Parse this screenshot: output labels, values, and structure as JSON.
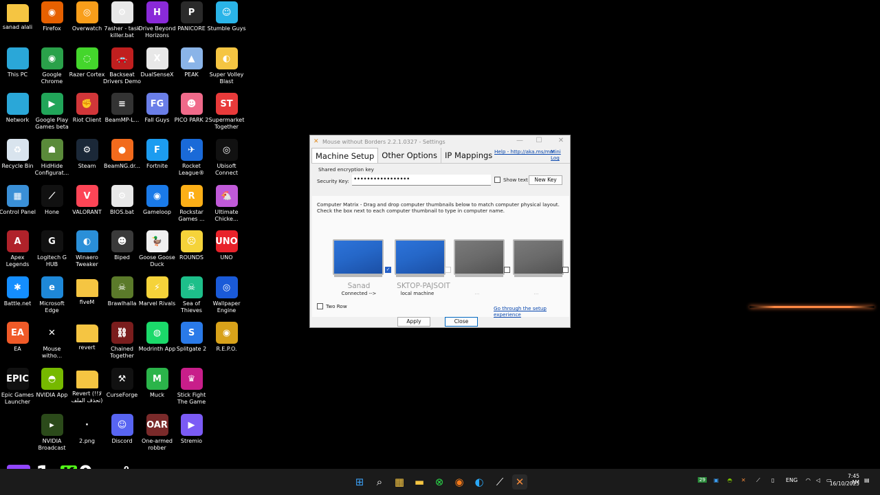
{
  "desktop": {
    "columns": [
      {
        "icons": [
          {
            "label": "sanad alali",
            "icon": "folder-icon",
            "color": "#f5c542",
            "glyph": ""
          },
          {
            "label": "This PC",
            "icon": "computer-icon",
            "color": "#2aa7d8",
            "glyph": ""
          },
          {
            "label": "Network",
            "icon": "network-icon",
            "color": "#2aa7d8",
            "glyph": ""
          },
          {
            "label": "Recycle Bin",
            "icon": "recycle-bin-icon",
            "color": "#d9e4ee",
            "glyph": "♻"
          },
          {
            "label": "Control Panel",
            "icon": "control-panel-icon",
            "color": "#3a8fd6",
            "glyph": "▦"
          },
          {
            "label": "Apex Legends",
            "icon": "apex-legends-icon",
            "color": "#b0222a",
            "glyph": "A"
          },
          {
            "label": "Battle.net",
            "icon": "battlenet-icon",
            "color": "#148eff",
            "glyph": "✱"
          },
          {
            "label": "EA",
            "icon": "ea-icon",
            "color": "#f05a28",
            "glyph": "EA"
          },
          {
            "label": "Epic Games Launcher",
            "icon": "epic-games-icon",
            "color": "#111111",
            "glyph": "EPIC"
          }
        ]
      },
      {
        "icons": [
          {
            "label": "Firefox",
            "icon": "firefox-icon",
            "color": "#e66000",
            "glyph": "◉"
          },
          {
            "label": "Google Chrome",
            "icon": "chrome-icon",
            "color": "#2aa14a",
            "glyph": "◉"
          },
          {
            "label": "Google Play Games beta",
            "icon": "google-play-games-icon",
            "color": "#21a559",
            "glyph": "▶"
          },
          {
            "label": "HidHide Configurat...",
            "icon": "hidhide-icon",
            "color": "#5a8a3a",
            "glyph": "☗"
          },
          {
            "label": "Hone",
            "icon": "hone-icon",
            "color": "#111111",
            "glyph": "⟋"
          },
          {
            "label": "Logitech G HUB",
            "icon": "logitech-ghub-icon",
            "color": "#111111",
            "glyph": "G"
          },
          {
            "label": "Microsoft Edge",
            "icon": "edge-icon",
            "color": "#1e88d8",
            "glyph": "e"
          },
          {
            "label": "Mouse witho...",
            "icon": "mouse-without-borders-icon",
            "color": "#000000",
            "glyph": "✕"
          },
          {
            "label": "NVIDIA App",
            "icon": "nvidia-app-icon",
            "color": "#76b900",
            "glyph": "◓"
          },
          {
            "label": "NVIDIA Broadcast",
            "icon": "nvidia-broadcast-icon",
            "color": "#2b4a1a",
            "glyph": "▸"
          }
        ]
      },
      {
        "icons": [
          {
            "label": "Overwatch",
            "icon": "overwatch-icon",
            "color": "#f99e1a",
            "glyph": "◎"
          },
          {
            "label": "Razer Cortex",
            "icon": "razer-cortex-icon",
            "color": "#44d62c",
            "glyph": "◌"
          },
          {
            "label": "Riot Client",
            "icon": "riot-client-icon",
            "color": "#d13639",
            "glyph": "✊"
          },
          {
            "label": "Steam",
            "icon": "steam-icon",
            "color": "#1b2838",
            "glyph": "⚙"
          },
          {
            "label": "VALORANT",
            "icon": "valorant-icon",
            "color": "#fd4556",
            "glyph": "V"
          },
          {
            "label": "Winaero Tweaker",
            "icon": "winaero-tweaker-icon",
            "color": "#2a8fd8",
            "glyph": "◐"
          },
          {
            "label": "fiveM",
            "icon": "folder-icon",
            "color": "#f5c542",
            "glyph": ""
          },
          {
            "label": "revert",
            "icon": "folder-icon",
            "color": "#f5c542",
            "glyph": ""
          },
          {
            "label": "Revert (!!لا تحذف الملف)",
            "icon": "folder-icon",
            "color": "#f5c542",
            "glyph": ""
          },
          {
            "label": "2.png",
            "icon": "image-file-icon",
            "color": "#000000",
            "glyph": "·"
          }
        ]
      },
      {
        "icons": [
          {
            "label": "7asher - task killer.bat",
            "icon": "batch-file-icon",
            "color": "#e8e8e8",
            "glyph": "⚙"
          },
          {
            "label": "Backseat Drivers Demo",
            "icon": "backseat-drivers-icon",
            "color": "#c01f1f",
            "glyph": "🚗"
          },
          {
            "label": "BeamMP-L...",
            "icon": "beammp-icon",
            "color": "#333333",
            "glyph": "≡"
          },
          {
            "label": "BeamNG.dr...",
            "icon": "beamng-icon",
            "color": "#f26b1d",
            "glyph": "●"
          },
          {
            "label": "BIOS.bat",
            "icon": "batch-file-icon",
            "color": "#e8e8e8",
            "glyph": "⚙"
          },
          {
            "label": "Biped",
            "icon": "biped-icon",
            "color": "#3a3a3a",
            "glyph": "☻"
          },
          {
            "label": "Brawlhalla",
            "icon": "brawlhalla-icon",
            "color": "#5b7a2a",
            "glyph": "☠"
          },
          {
            "label": "Chained Together",
            "icon": "chained-together-icon",
            "color": "#7a1d1d",
            "glyph": "⛓"
          },
          {
            "label": "CurseForge",
            "icon": "curseforge-icon",
            "color": "#111111",
            "glyph": "⚒"
          },
          {
            "label": "Discord",
            "icon": "discord-icon",
            "color": "#5865f2",
            "glyph": "☺"
          }
        ]
      },
      {
        "icons": [
          {
            "label": "Drive Beyond Horizons",
            "icon": "drive-beyond-horizons-icon",
            "color": "#8a2ad8",
            "glyph": "H"
          },
          {
            "label": "DualSenseX",
            "icon": "dualsensex-icon",
            "color": "#e8e8e8",
            "glyph": "X"
          },
          {
            "label": "Fall Guys",
            "icon": "fall-guys-icon",
            "color": "#6a7ee8",
            "glyph": "FG"
          },
          {
            "label": "Fortnite",
            "icon": "fortnite-icon",
            "color": "#1c9cf0",
            "glyph": "F"
          },
          {
            "label": "Gameloop",
            "icon": "gameloop-icon",
            "color": "#1a7ae8",
            "glyph": "◉"
          },
          {
            "label": "Goose Goose Duck",
            "icon": "goose-goose-duck-icon",
            "color": "#f0f0f0",
            "glyph": "🦆"
          },
          {
            "label": "Marvel Rivals",
            "icon": "marvel-rivals-icon",
            "color": "#f5d33a",
            "glyph": "⚡"
          },
          {
            "label": "Modrinth App",
            "icon": "modrinth-icon",
            "color": "#1bd96a",
            "glyph": "◍"
          },
          {
            "label": "Muck",
            "icon": "muck-icon",
            "color": "#2bb44a",
            "glyph": "M"
          },
          {
            "label": "One-armed robber",
            "icon": "one-armed-robber-icon",
            "color": "#7a2a2a",
            "glyph": "OAR"
          }
        ]
      },
      {
        "icons": [
          {
            "label": "PANICORE",
            "icon": "panicore-icon",
            "color": "#2a2a2a",
            "glyph": "P"
          },
          {
            "label": "PEAK",
            "icon": "peak-icon",
            "color": "#8ab4e8",
            "glyph": "▲"
          },
          {
            "label": "PICO PARK 2",
            "icon": "pico-park-2-icon",
            "color": "#f06a8a",
            "glyph": "☻"
          },
          {
            "label": "Rocket League®",
            "icon": "rocket-league-icon",
            "color": "#1a6ad8",
            "glyph": "✈"
          },
          {
            "label": "Rockstar Games ...",
            "icon": "rockstar-games-icon",
            "color": "#fcaf17",
            "glyph": "R"
          },
          {
            "label": "ROUNDS",
            "icon": "rounds-icon",
            "color": "#f5d33a",
            "glyph": "☹"
          },
          {
            "label": "Sea of Thieves",
            "icon": "sea-of-thieves-icon",
            "color": "#1dbf8a",
            "glyph": "☠"
          },
          {
            "label": "Splitgate 2",
            "icon": "splitgate-2-icon",
            "color": "#2a7ae8",
            "glyph": "S"
          },
          {
            "label": "Stick Fight The Game",
            "icon": "stick-fight-icon",
            "color": "#c81e8a",
            "glyph": "♛"
          },
          {
            "label": "Stremio",
            "icon": "stremio-icon",
            "color": "#7b5bf5",
            "glyph": "▶"
          }
        ]
      },
      {
        "icons": [
          {
            "label": "Stumble Guys",
            "icon": "stumble-guys-icon",
            "color": "#2ab4e8",
            "glyph": "☺"
          },
          {
            "label": "Super Volley Blast",
            "icon": "super-volley-blast-icon",
            "color": "#f5c542",
            "glyph": "◐"
          },
          {
            "label": "Supermarket Together",
            "icon": "supermarket-together-icon",
            "color": "#e83a3a",
            "glyph": "ST"
          },
          {
            "label": "Ubisoft Connect",
            "icon": "ubisoft-connect-icon",
            "color": "#111111",
            "glyph": "◎"
          },
          {
            "label": "Ultimate Chicke...",
            "icon": "ultimate-chicken-horse-icon",
            "color": "#c05ad8",
            "glyph": "🐔"
          },
          {
            "label": "UNO",
            "icon": "uno-icon",
            "color": "#e8222a",
            "glyph": "UNO"
          },
          {
            "label": "Wallpaper Engine",
            "icon": "wallpaper-engine-icon",
            "color": "#1a5ad8",
            "glyph": "◎"
          },
          {
            "label": "R.E.P.O.",
            "icon": "repo-icon",
            "color": "#d8a21a",
            "glyph": "◉"
          }
        ]
      }
    ]
  },
  "dialog": {
    "title": "Mouse without Borders 2.2.1.0327 - Settings",
    "tabs": [
      "Machine Setup",
      "Other Options",
      "IP Mappings"
    ],
    "help_link": "Help - http://aka.ms/mm",
    "mini_log_link": "Mini Log",
    "shared_key_label": "Shared encryption key",
    "security_key_label": "Security Key:",
    "security_key_value": "•••••••••••••••••",
    "show_text_label": "Show text",
    "new_key_label": "New Key",
    "matrix_text": "Computer Matrix  - Drag and drop computer thumbnails below to match computer physical layout. Check the box next to each computer thumbnail to type in computer name.",
    "machines": [
      {
        "name": "Sanad",
        "status": "Connected -->",
        "checked": true,
        "active": true
      },
      {
        "name": "SKTOP-PAJSOIT",
        "status": "local machine",
        "checked": false,
        "active": true
      },
      {
        "name": "",
        "status": "...",
        "checked": false,
        "active": false
      },
      {
        "name": "",
        "status": "...",
        "checked": false,
        "active": false
      }
    ],
    "two_row_label": "Two Row",
    "setup_link": "Go through the setup experience",
    "apply_label": "Apply",
    "close_label": "Close"
  },
  "overlay": {
    "stat1_value": "1",
    "stat2_value": "0",
    "stat3_top": "0",
    "stat3_bottom": "0"
  },
  "taskbar": {
    "apps": [
      {
        "icon": "start-icon"
      },
      {
        "icon": "search-icon"
      },
      {
        "icon": "microsoft-store-icon"
      },
      {
        "icon": "file-explorer-icon"
      },
      {
        "icon": "xbox-icon"
      },
      {
        "icon": "firefox-icon"
      },
      {
        "icon": "edge-icon"
      },
      {
        "icon": "hone-icon"
      },
      {
        "icon": "mouse-without-borders-icon"
      }
    ],
    "tray": {
      "language": "ENG",
      "time": "7:45 AM",
      "date": "16/10/2025",
      "badge": "29"
    }
  }
}
